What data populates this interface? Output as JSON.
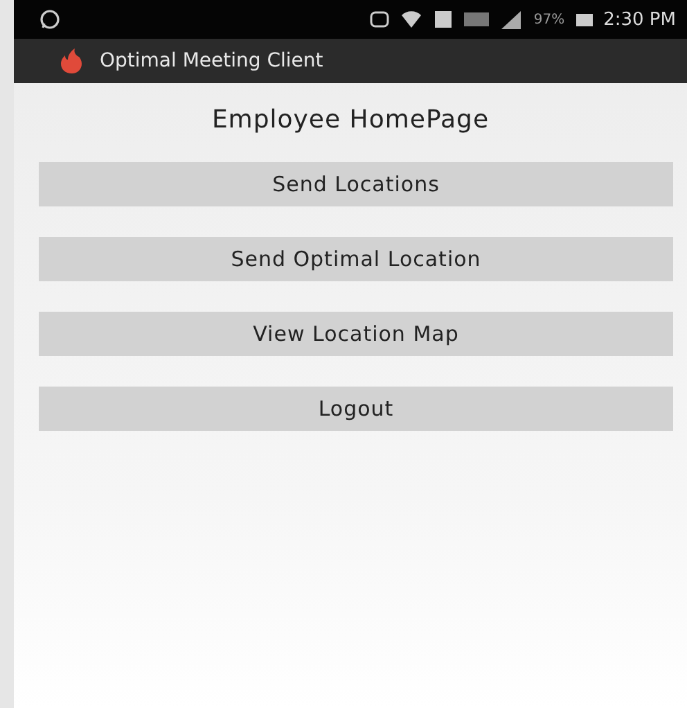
{
  "status_bar": {
    "battery": "97%",
    "time": "2:30 PM"
  },
  "app_bar": {
    "title": "Optimal Meeting Client"
  },
  "page_title": "Employee HomePage",
  "buttons": [
    "Send Locations",
    "Send Optimal Location",
    "View Location Map",
    "Logout"
  ]
}
